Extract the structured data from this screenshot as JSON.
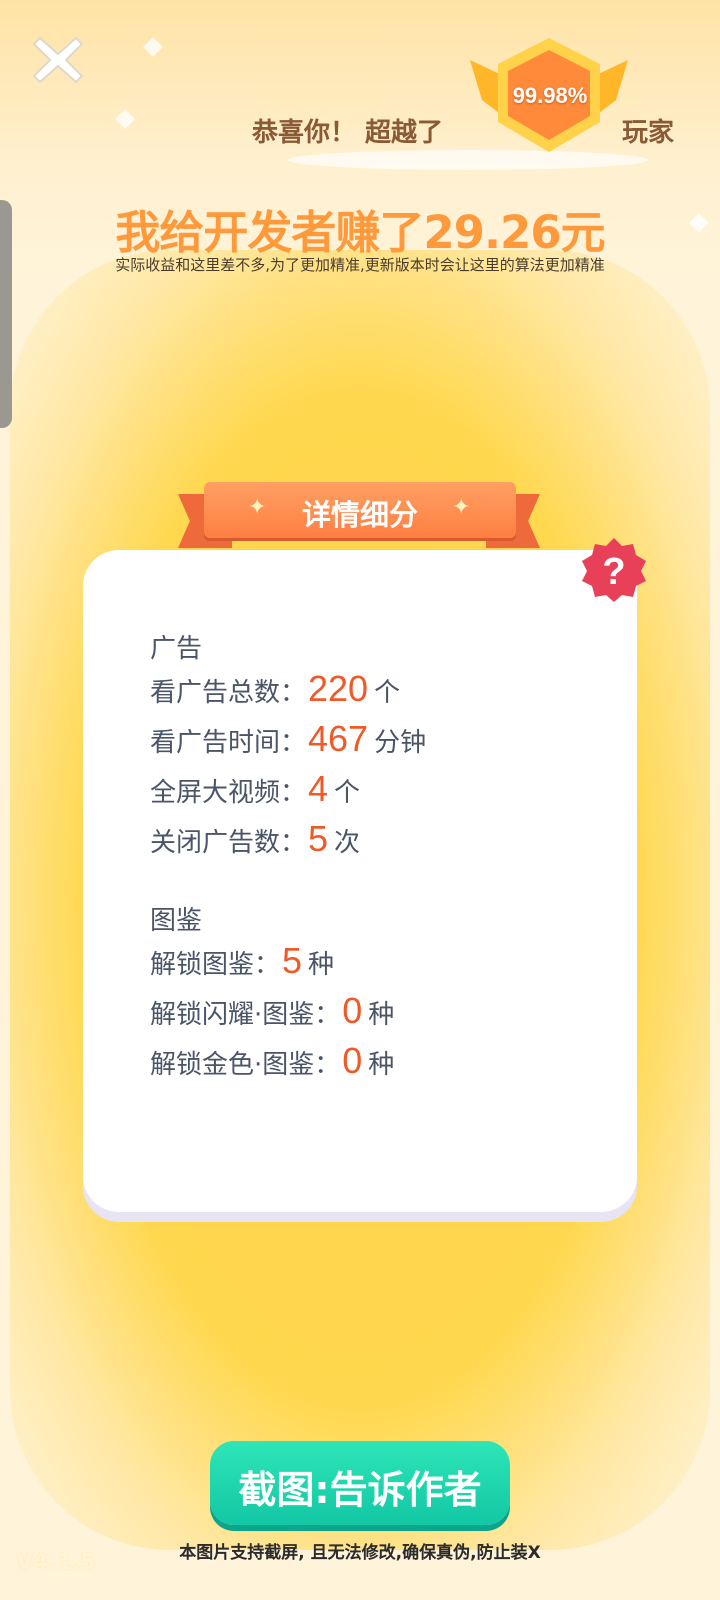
{
  "header": {
    "congrats_prefix": "恭喜你！ 超越了",
    "congrats_suffix": "玩家",
    "percentile": "99.98%"
  },
  "earnings": {
    "headline": "我给开发者赚了29.26元",
    "note": "实际收益和这里差不多,为了更加精准,更新版本时会让这里的算法更加精准"
  },
  "details": {
    "ribbon_label": "详情细分",
    "ads": {
      "title": "广告",
      "rows": [
        {
          "label": "看广告总数：",
          "value": "220",
          "unit": "个"
        },
        {
          "label": "看广告时间：",
          "value": "467",
          "unit": "分钟"
        },
        {
          "label": "全屏大视频：",
          "value": "4",
          "unit": "个"
        },
        {
          "label": "关闭广告数：",
          "value": "5",
          "unit": "次"
        }
      ]
    },
    "collection": {
      "title": "图鉴",
      "rows": [
        {
          "label": "解锁图鉴：",
          "value": "5",
          "unit": "种"
        },
        {
          "label": "解锁闪耀·图鉴：",
          "value": "0",
          "unit": "种"
        },
        {
          "label": "解锁金色·图鉴：",
          "value": "0",
          "unit": "种"
        }
      ]
    }
  },
  "actions": {
    "share_label": "截图:告诉作者"
  },
  "footer": {
    "note": "本图片支持截屏, 且无法修改,确保真伪,防止装X",
    "version": "V4.1.5"
  },
  "colors": {
    "accent_orange": "#ff9a3c",
    "value_red": "#f05a28",
    "button_teal": "#12c7a4"
  }
}
